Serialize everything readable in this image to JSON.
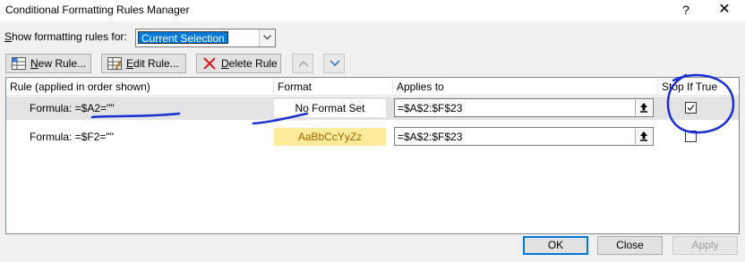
{
  "window": {
    "title": "Conditional Formatting Rules Manager",
    "help_glyph": "?",
    "close_glyph": "✕"
  },
  "show_for": {
    "label_pre": "",
    "label_mnemonic": "S",
    "label_post": "how formatting rules for:",
    "selected": "Current Selection"
  },
  "toolbar": {
    "new_rule": {
      "mnemonic": "N",
      "rest": "ew Rule..."
    },
    "edit_rule": {
      "mnemonic": "E",
      "rest": "dit Rule..."
    },
    "delete_rule": {
      "mnemonic": "D",
      "rest": "elete Rule"
    },
    "move_up": "up-arrow-icon",
    "move_down": "down-arrow-icon"
  },
  "grid": {
    "headers": {
      "rule": "Rule (applied in order shown)",
      "format": "Format",
      "applies_to": "Applies to",
      "stop_if_true": "Stop If True"
    },
    "rows": [
      {
        "rule": "Formula: =$A2=\"\"",
        "format": "No Format Set",
        "applies_to": "=$A$2:$F$23",
        "stop_if_true": true
      },
      {
        "rule": "Formula: =$F2=\"\"",
        "format": "AaBbCcYyZz",
        "applies_to": "=$A$2:$F$23",
        "stop_if_true": false
      }
    ]
  },
  "buttons": {
    "ok": "OK",
    "close": "Close",
    "apply": "Apply"
  },
  "colors": {
    "accent": "#0078d7",
    "sample_fill": "#ffeb9c",
    "sample_text": "#9c6500",
    "annotation_ink": "#1a2fd0"
  }
}
